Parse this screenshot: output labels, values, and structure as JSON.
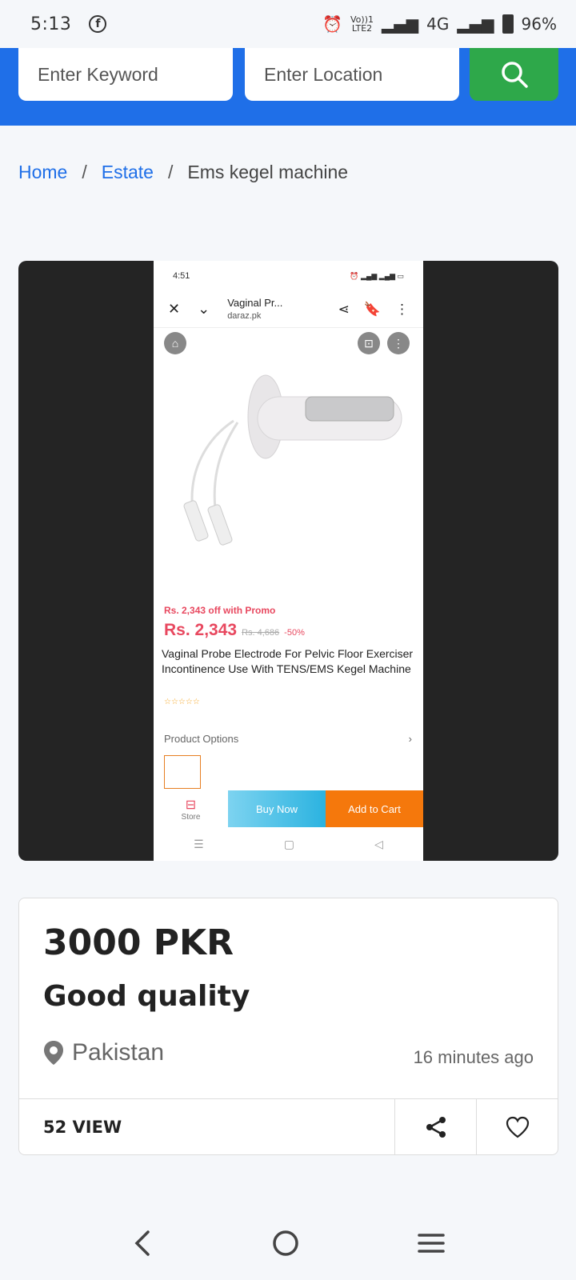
{
  "status_bar": {
    "time": "5:13",
    "network_top": "Vo))1",
    "network_bottom": "LTE2",
    "net_type": "4G",
    "battery": "96%"
  },
  "search": {
    "keyword_placeholder": "Enter Keyword",
    "location_placeholder": "Enter Location"
  },
  "breadcrumb": {
    "home": "Home",
    "sep": "/",
    "category": "Estate",
    "current": "Ems kegel machine"
  },
  "screenshot": {
    "time": "4:51",
    "page_title": "Vaginal Pr...",
    "domain": "daraz.pk",
    "promo": "Rs. 2,343 off with Promo",
    "price": "Rs. 2,343",
    "old_price": "Rs. 4,686",
    "discount": "-50%",
    "product_title": "Vaginal Probe Electrode For Pelvic Floor Exerciser Incontinence Use With TENS/EMS Kegel Machine",
    "stars": "☆☆☆☆☆",
    "product_options": "Product Options",
    "store": "Store",
    "buy_now": "Buy Now",
    "add_to_cart": "Add to Cart"
  },
  "listing": {
    "price": "3000 PKR",
    "headline": "Good quality",
    "location": "Pakistan",
    "posted": "16 minutes ago",
    "views": "52 VIEW"
  },
  "colors": {
    "primary": "#1f6fe8",
    "search_btn": "#2ea84a",
    "price_red": "#e8485f",
    "cart_orange": "#f5780c"
  }
}
